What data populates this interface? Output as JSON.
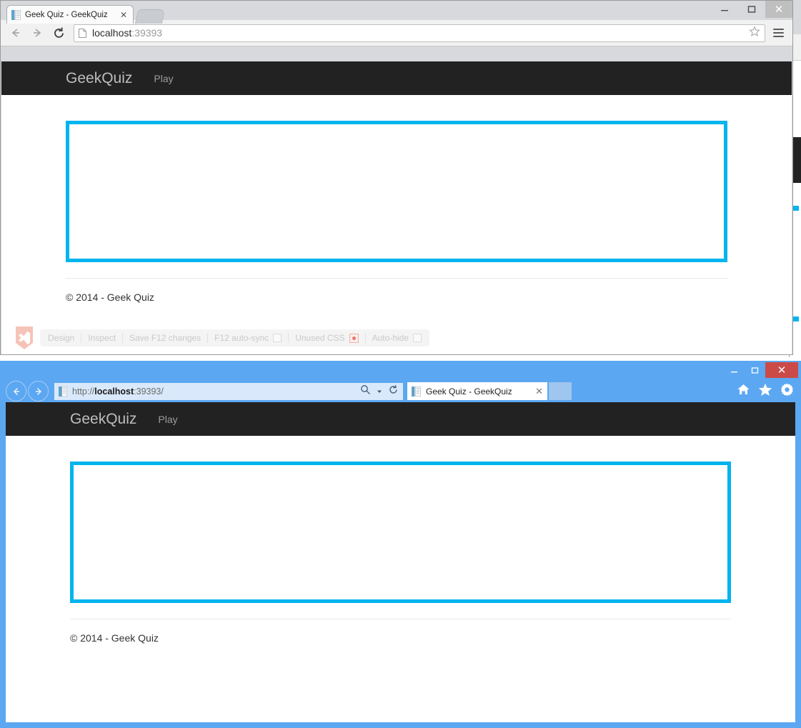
{
  "background_window": {
    "description": "partially-hidden browser window behind"
  },
  "chrome_window": {
    "titlebar": {
      "minimize_label": "–",
      "maximize_label": "□",
      "close_label": "✕"
    },
    "tabs": [
      {
        "title": "Geek Quiz - GeekQuiz",
        "close_label": "✕",
        "favicon": "page-favicon"
      }
    ],
    "new_tab_label": "",
    "toolbar": {
      "back_label": "←",
      "forward_label": "→",
      "reload_label": "⟳",
      "url_host": "localhost",
      "url_rest": ":39393",
      "bookmark_label": "☆",
      "menu_label": "menu"
    },
    "page": {
      "brand": "GeekQuiz",
      "navlinks": [
        "Play"
      ],
      "footer": "© 2014 - Geek Quiz",
      "accent_color": "#00b4ef",
      "navbar_color": "#222222"
    },
    "browser_link": {
      "logo_name": "visual-studio-logo",
      "items": [
        {
          "label": "Design",
          "control": "none"
        },
        {
          "label": "Inspect",
          "control": "none"
        },
        {
          "label": "Save F12 changes",
          "control": "none"
        },
        {
          "label": "F12 auto-sync",
          "control": "checkbox"
        },
        {
          "label": "Unused CSS",
          "control": "record"
        },
        {
          "label": "Auto-hide",
          "control": "checkbox"
        }
      ]
    }
  },
  "ie_window": {
    "titlebar": {
      "minimize_label": "–",
      "maximize_label": "□",
      "close_label": "✕"
    },
    "toolbar": {
      "back_label": "←",
      "forward_label": "→",
      "url_prefix": "http://",
      "url_host": "localhost",
      "url_rest": ":39393/",
      "search_label": "⌕",
      "search_caret": "▾",
      "refresh_label": "⟳"
    },
    "tabs": [
      {
        "title": "Geek Quiz - GeekQuiz",
        "close_label": "✕",
        "favicon": "page-favicon"
      }
    ],
    "right_icons": [
      "home-icon",
      "favorites-icon",
      "settings-icon"
    ],
    "page": {
      "brand": "GeekQuiz",
      "navlinks": [
        "Play"
      ],
      "footer": "© 2014 - Geek Quiz",
      "accent_color": "#00b4ef",
      "navbar_color": "#222222"
    },
    "frame_color": "#5ba7f2"
  }
}
